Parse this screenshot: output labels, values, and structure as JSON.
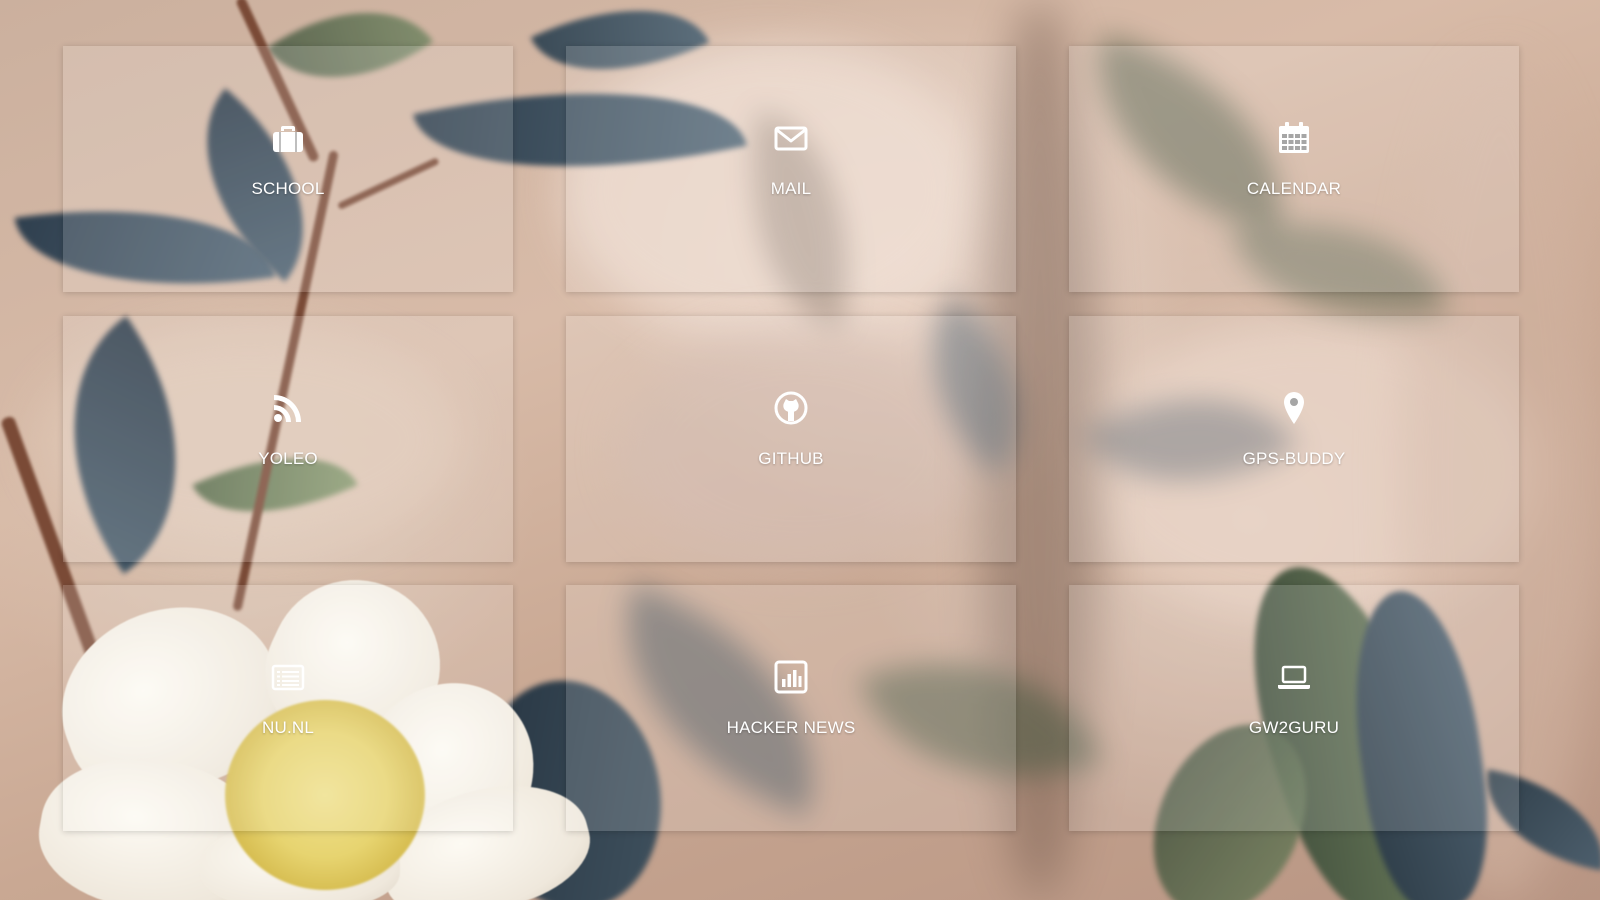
{
  "tiles": [
    {
      "label": "SCHOOL",
      "icon": "briefcase-icon"
    },
    {
      "label": "MAIL",
      "icon": "envelope-icon"
    },
    {
      "label": "CALENDAR",
      "icon": "calendar-icon"
    },
    {
      "label": "YOLEO",
      "icon": "rss-icon"
    },
    {
      "label": "GITHUB",
      "icon": "github-icon"
    },
    {
      "label": "GPS-BUDDY",
      "icon": "map-pin-icon"
    },
    {
      "label": "NU.NL",
      "icon": "newspaper-icon"
    },
    {
      "label": "HACKER NEWS",
      "icon": "bar-chart-icon"
    },
    {
      "label": "GW2GURU",
      "icon": "laptop-icon"
    }
  ],
  "colors": {
    "tile_background": "rgba(255,255,255,0.16)",
    "text": "#ffffff"
  }
}
